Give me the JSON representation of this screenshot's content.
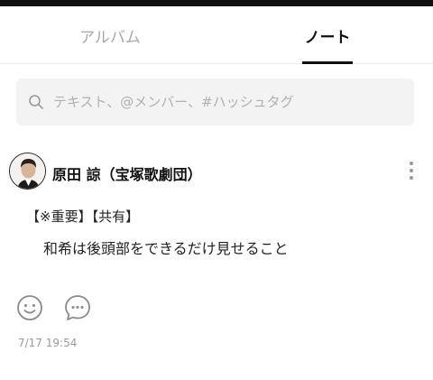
{
  "tabs": [
    {
      "label": "アルバム",
      "active": false
    },
    {
      "label": "ノート",
      "active": true
    }
  ],
  "search": {
    "placeholder": "テキスト、@メンバー、#ハッシュタグ",
    "value": ""
  },
  "post": {
    "author": "原田 諒（宝塚歌劇団）",
    "tags": "【※重要】【共有】",
    "body": "和希は後頭部をできるだけ見せること",
    "timestamp": "7/17 19:54"
  },
  "colors": {
    "active_tab": "#111111",
    "inactive_tab": "#a7a7a7",
    "search_bg": "#f3f3f3",
    "icon": "#8a8a8a"
  },
  "icons": {
    "search": "search-icon",
    "more": "more-vertical-icon",
    "like": "smiley-icon",
    "comment": "comment-bubble-icon"
  }
}
